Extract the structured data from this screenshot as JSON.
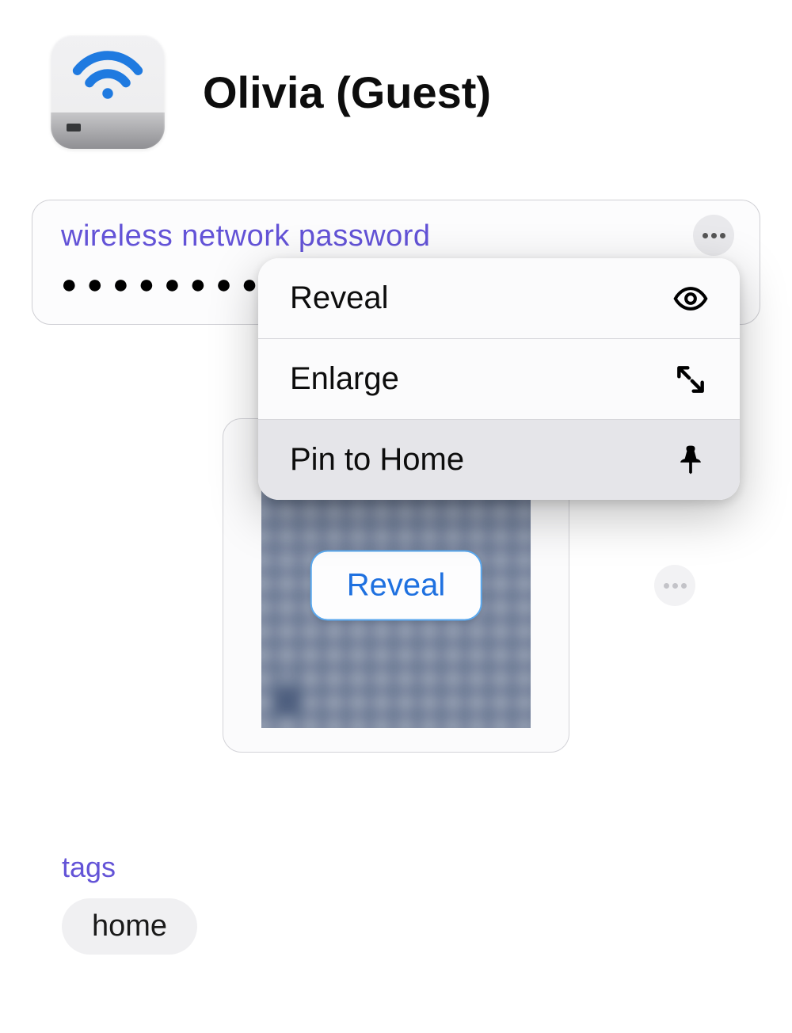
{
  "header": {
    "title": "Olivia (Guest)",
    "icon": "wifi-router-icon"
  },
  "password_field": {
    "label": "wireless network password",
    "masked_value": "●●●●●●●●●●●●",
    "more_icon": "more-horizontal-icon"
  },
  "context_menu": {
    "items": [
      {
        "label": "Reveal",
        "icon": "eye-icon"
      },
      {
        "label": "Enlarge",
        "icon": "expand-icon"
      },
      {
        "label": "Pin to Home",
        "icon": "pin-icon"
      }
    ]
  },
  "qr_section": {
    "reveal_label": "Reveal",
    "more_icon": "more-horizontal-icon"
  },
  "tags": {
    "label": "tags",
    "items": [
      "home"
    ]
  }
}
